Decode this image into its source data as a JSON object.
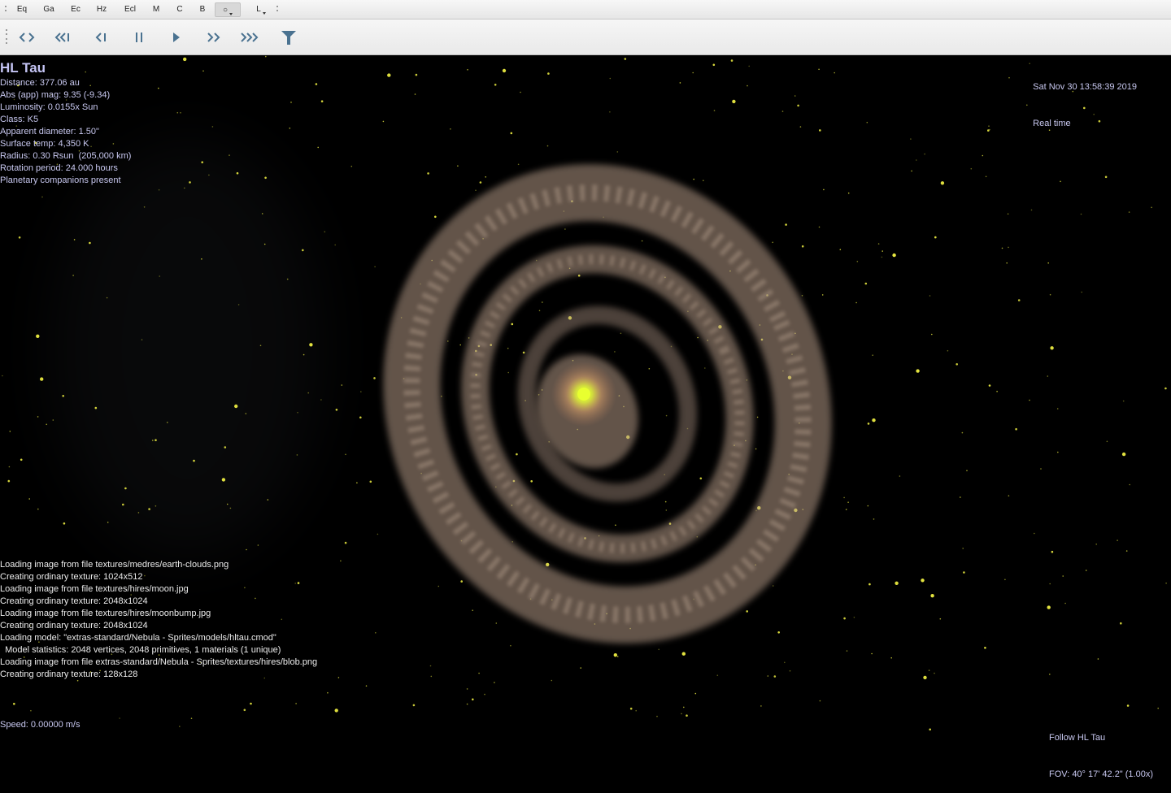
{
  "render_toolbar": {
    "buttons": [
      "Eq",
      "Ga",
      "Ec",
      "Hz",
      "Ecl",
      "M",
      "C",
      "B",
      "○",
      "L"
    ]
  },
  "time_toolbar": {
    "icons": [
      "reverse-time-icon",
      "slower-icon",
      "step-back-icon",
      "pause-icon",
      "play-icon",
      "faster-icon",
      "much-faster-icon",
      "filter-icon"
    ],
    "accent_color": "#4a7290"
  },
  "object": {
    "name": "HL Tau",
    "info_lines": [
      "Distance: 377.06 au",
      "Abs (app) mag: 9.35 (-9.34)",
      "Luminosity: 0.0155x Sun",
      "Class: K5",
      "Apparent diameter: 1.50\"",
      "Surface temp: 4,350 K",
      "Radius: 0.30 Rsun  (205,000 km)",
      "Rotation period: 24.000 hours",
      "Planetary companions present"
    ]
  },
  "time": {
    "date": "Sat Nov 30 13:58:39 2019",
    "mode": "Real time"
  },
  "console_log": [
    "Loading image from file textures/medres/earth-clouds.png",
    "Creating ordinary texture: 1024x512",
    "Loading image from file textures/hires/moon.jpg",
    "Creating ordinary texture: 2048x1024",
    "Loading image from file textures/hires/moonbump.jpg",
    "Creating ordinary texture: 2048x1024",
    "Loading model: \"extras-standard/Nebula - Sprites/models/hltau.cmod\"",
    "  Model statistics: 2048 vertices, 2048 primitives, 1 materials (1 unique)",
    "Loading image from file extras-standard/Nebula - Sprites/textures/hires/blob.png",
    "Creating ordinary texture: 128x128"
  ],
  "status": {
    "speed": "Speed: 0.00000 m/s",
    "follow": "Follow HL Tau",
    "fov": "FOV: 40° 17' 42.2\" (1.00x)"
  },
  "colors": {
    "hud_text": "#c8c8f0",
    "log_text": "#ececec",
    "disk": "#b49a86",
    "star_core": "#e8ff30",
    "stars": "#e6e640"
  }
}
